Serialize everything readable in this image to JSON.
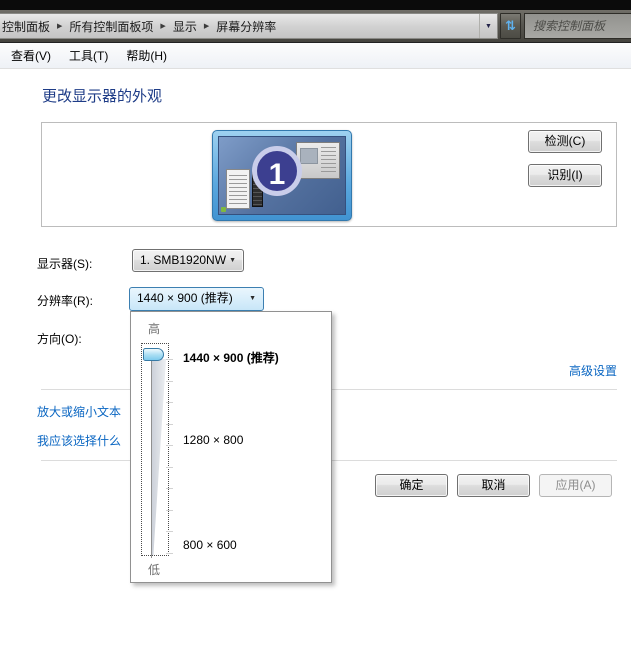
{
  "address_bar": {
    "breadcrumb": [
      {
        "label": "控制面板"
      },
      {
        "label": "所有控制面板项"
      },
      {
        "label": "显示"
      },
      {
        "label": "屏幕分辨率"
      }
    ],
    "search_placeholder": "搜索控制面板"
  },
  "menu_bar": {
    "items": [
      {
        "label": "查看(V)"
      },
      {
        "label": "工具(T)"
      },
      {
        "label": "帮助(H)"
      }
    ]
  },
  "icons": {
    "breadcrumb_arrow": "▶",
    "dropdown_arrow": "▼",
    "address_dropdown_arrow": "▼",
    "refresh": "⇅"
  },
  "page": {
    "title": "更改显示器的外观",
    "monitor_number": "1",
    "detect_button": "检测(C)",
    "identify_button": "识别(I)",
    "display_label": "显示器(S):",
    "display_value": "1. SMB1920NW",
    "resolution_label": "分辨率(R):",
    "resolution_value": "1440 × 900 (推荐)",
    "orientation_label": "方向(O):",
    "advanced_settings_link": "高级设置",
    "make_text_larger_link": "放大或缩小文本",
    "what_settings_link": "我应该选择什么",
    "ok_button": "确定",
    "cancel_button": "取消",
    "apply_button": "应用(A)"
  },
  "resolution_dropdown": {
    "high_label": "高",
    "low_label": "低",
    "options": [
      {
        "label": "1440 × 900 (推荐)",
        "selected": true
      },
      {
        "label": "1280 × 800",
        "selected": false
      },
      {
        "label": "800 × 600",
        "selected": false
      }
    ],
    "current_value": "1440 × 900 (推荐)"
  },
  "colors": {
    "title_text": "#1e3c87",
    "link_text": "#0a66c2",
    "combo_open_fill": "#c8e6f8",
    "combo_open_border": "#3c7fb1",
    "monitor_bezel": "#5aa7de",
    "monitor_circle": "#3c3f90",
    "addressbar_glass": "#575650"
  }
}
